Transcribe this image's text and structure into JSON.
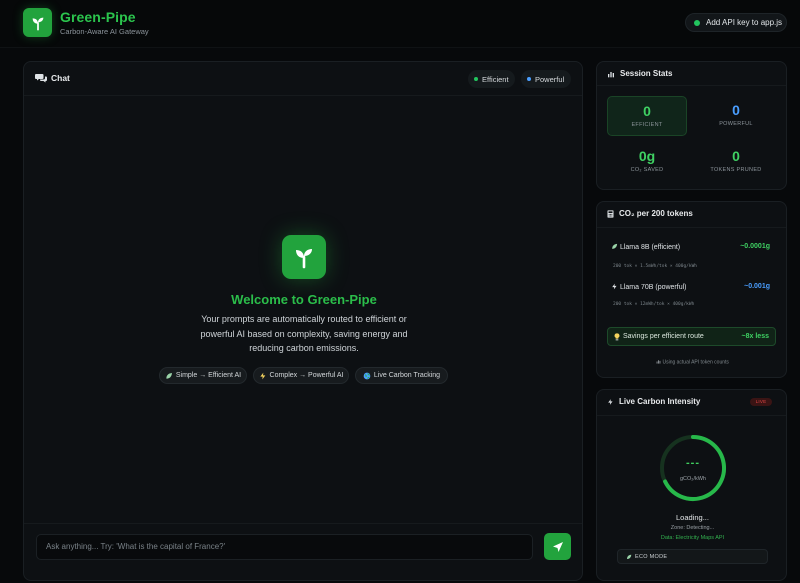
{
  "header": {
    "title": "Green-Pipe",
    "subtitle": "Carbon-Aware AI Gateway",
    "api_label": "Add API key to app.js",
    "logo_icon": "sprout-icon"
  },
  "chat": {
    "title": "Chat",
    "mode_efficient": "Efficient",
    "mode_powerful": "Powerful",
    "welcome_title": "Welcome to Green-Pipe",
    "welcome_text": "Your prompts are automatically routed to efficient or powerful AI based on complexity, saving energy and reducing carbon emissions.",
    "features": [
      {
        "icon": "leaf-icon",
        "label": "Simple → Efficient AI"
      },
      {
        "icon": "bolt-icon",
        "label": "Complex → Powerful AI"
      },
      {
        "icon": "globe-icon",
        "label": "Live Carbon Tracking"
      }
    ],
    "input_placeholder": "Ask anything... Try: 'What is the capital of France?'",
    "send_icon": "send-icon"
  },
  "stats": {
    "title": "Session Stats",
    "efficient_value": "0",
    "efficient_label": "EFFICIENT",
    "powerful_value": "0",
    "powerful_label": "POWERFUL",
    "co2_value": "0g",
    "co2_label": "CO₂ SAVED",
    "tokens_value": "0",
    "tokens_label": "TOKENS PRUNED"
  },
  "co2": {
    "title": "CO₂ per 200 tokens",
    "llama8_name": "Llama 8B (efficient)",
    "llama8_value": "~0.0001g",
    "llama8_calc": "200 tok × 1.5mWh/tok × 400g/kWh",
    "llama70_name": "Llama 70B (powerful)",
    "llama70_value": "~0.001g",
    "llama70_calc": "200 tok × 12mWh/tok × 400g/kWh",
    "savings_label": "Savings per efficient route",
    "savings_value": "~8x less",
    "note": "Using actual API token counts"
  },
  "live": {
    "title": "Live Carbon Intensity",
    "badge": "LIVE",
    "gauge_value": "---",
    "gauge_unit": "gCO₂/kWh",
    "status": "Loading...",
    "zone": "Zone: Detecting...",
    "source": "Data: Electricity Maps API",
    "eco_mode": "ECO MODE"
  },
  "colors": {
    "accent": "#22a33d",
    "accent_bright": "#2bc44d",
    "efficient": "#22c55e",
    "powerful": "#4a9eff",
    "live_red": "#e04545"
  }
}
